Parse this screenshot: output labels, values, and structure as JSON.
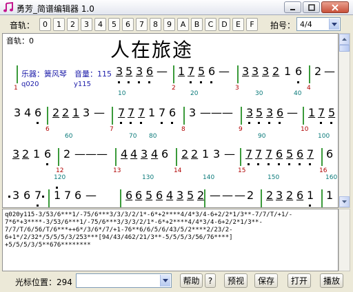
{
  "window": {
    "title": "勇芳_简谱编辑器 1.0"
  },
  "toolbar": {
    "track_label": "音轨：",
    "tracks": [
      "0",
      "1",
      "2",
      "3",
      "4",
      "5",
      "6",
      "7",
      "8",
      "9",
      "A",
      "B",
      "C",
      "D",
      "E",
      "F"
    ],
    "beat_label": "拍号：",
    "beat_value": "4/4"
  },
  "score": {
    "track_label": "音轨：0",
    "title": "人在旅途",
    "instrument_label": "乐器：簧风琴",
    "volume_label": "音量：115",
    "instrument_code": "q020",
    "volume_code": "y115",
    "measure_numbers": [
      "1",
      "2",
      "3",
      "4",
      "5",
      "6",
      "7",
      "8",
      "9",
      "10",
      "11",
      "12",
      "13",
      "14",
      "15",
      "16"
    ],
    "beat_numbers": [
      "10",
      "20",
      "30",
      "40",
      "50",
      "60",
      "70",
      "80",
      "90",
      "100",
      "110",
      "120",
      "130",
      "140",
      "150",
      "160"
    ],
    "row1": [
      "3",
      "5",
      "3",
      "6",
      "—",
      "1",
      "7",
      "5",
      "6",
      "—",
      "3",
      "3",
      "3",
      "2",
      "1",
      "6",
      "2",
      "—"
    ],
    "row2": [
      "3",
      "4",
      "6",
      "2",
      "2",
      "1",
      "3",
      "—",
      "7",
      "7",
      "7",
      "1",
      "7",
      "6",
      "3",
      "—",
      "—",
      "—",
      "3",
      "5",
      "3",
      "6",
      "—",
      "1",
      "7",
      "5"
    ],
    "row3": [
      "3",
      "2",
      "1",
      "6",
      "2",
      "—",
      "—",
      "—",
      "4",
      "4",
      "3",
      "4",
      "6",
      "2",
      "2",
      "1",
      "3",
      "—",
      "7",
      "7",
      "7",
      "6",
      "5",
      "6",
      "7",
      "6"
    ],
    "row4": [
      "3",
      "6",
      "7",
      "1",
      "7",
      "6",
      "—",
      "6",
      "6",
      "5",
      "6",
      "4",
      "3",
      "5",
      "2",
      "—",
      "—",
      "—",
      "2",
      "2",
      "3",
      "2",
      "6",
      "1"
    ]
  },
  "code_text": "q020y115-3/53/6***1/-75/6***3/3/3/2/1*-6*+2****4/4*3/4-6+2/2*1/3**-7/7/T/+1/-\n7*6*+3****-3/53/6***1/-75/6***3/3/3/2/1*-6*+2****4/4*3/4-6+2/2*1/3**-\n7/7/T/6/56/T/6***++6*/3/6*/7/+1-76**6/6/5/6/43/5/2****2/23/2-\n6+1*/2/32*/5/5/5/3/253***[94/43/462/21/3**-5/5/5/3/56/76****]\n+5/5/5/3/5**676********",
  "status": {
    "cursor_label": "光标位置：294",
    "help": "帮助",
    "question": "?",
    "preview": "预视",
    "save": "保存",
    "open": "打开",
    "play": "播放"
  }
}
